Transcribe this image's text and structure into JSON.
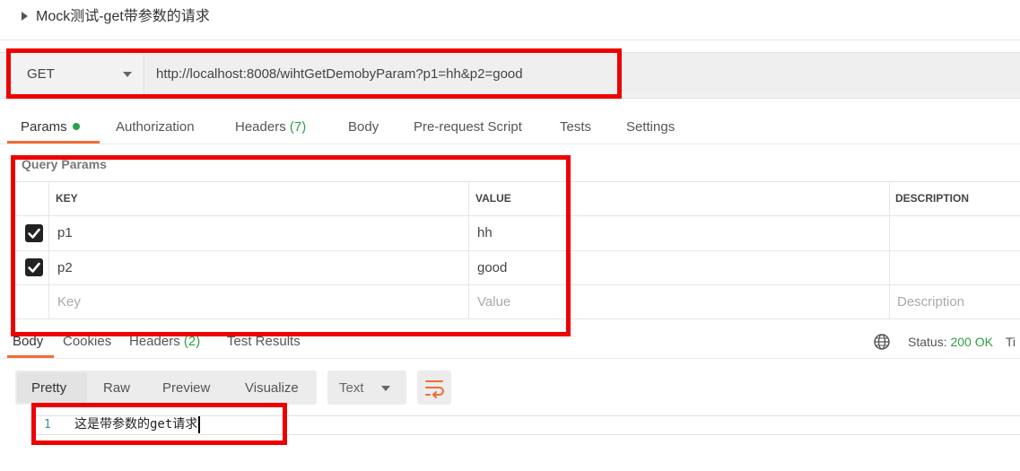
{
  "request": {
    "title": "Mock测试-get带参数的请求",
    "method": "GET",
    "url": "http://localhost:8008/wihtGetDemobyParam?p1=hh&p2=good"
  },
  "request_tabs": {
    "params": "Params",
    "authorization": "Authorization",
    "headers": "Headers",
    "headers_count": "(7)",
    "body": "Body",
    "prerequest": "Pre-request Script",
    "tests": "Tests",
    "settings": "Settings"
  },
  "query_params": {
    "label": "Query Params",
    "columns": {
      "key": "KEY",
      "value": "VALUE",
      "description": "DESCRIPTION"
    },
    "rows": [
      {
        "checked": true,
        "key": "p1",
        "value": "hh",
        "description": ""
      },
      {
        "checked": true,
        "key": "p2",
        "value": "good",
        "description": ""
      }
    ],
    "placeholders": {
      "key": "Key",
      "value": "Value",
      "description": "Description"
    }
  },
  "response_tabs": {
    "body": "Body",
    "cookies": "Cookies",
    "headers": "Headers",
    "headers_count": "(2)",
    "test_results": "Test Results"
  },
  "status": {
    "label": "Status:",
    "value": "200 OK",
    "time_label": "Ti"
  },
  "format_toolbar": {
    "pretty": "Pretty",
    "raw": "Raw",
    "preview": "Preview",
    "visualize": "Visualize",
    "text_select": "Text"
  },
  "response_body": {
    "line_number": "1",
    "content": "这是带参数的get请求"
  },
  "colors": {
    "accent": "#f06d33",
    "success": "#2ea043",
    "highlight_box": "#ee0000"
  },
  "icons": [
    "caret-right-icon",
    "chevron-down-icon",
    "checkbox-checked-icon",
    "globe-icon",
    "wrap-lines-icon"
  ]
}
